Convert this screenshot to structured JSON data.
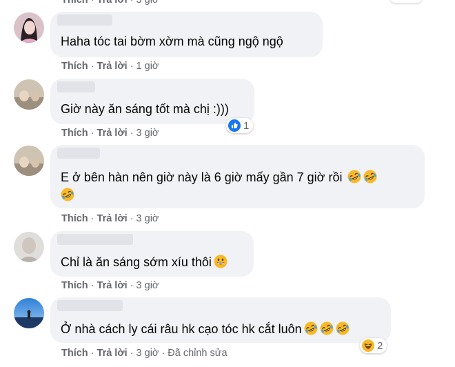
{
  "top_fragment": {
    "like": "Thích",
    "reply": "Trả lời",
    "time": "3 giờ"
  },
  "comments": [
    {
      "text": "Haha tóc tai bờm xờm mà cũng ngộ ngộ",
      "actions": {
        "like": "Thích",
        "reply": "Trả lời",
        "time": "1 giờ"
      }
    },
    {
      "text": "Giờ này ăn sáng tốt mà chị :)))",
      "reactions": {
        "count": "1",
        "icon": "like-icon"
      },
      "actions": {
        "like": "Thích",
        "reply": "Trả lời",
        "time": "3 giờ"
      }
    },
    {
      "text_line1": "E ở bên hàn nên giờ này là 6 giờ mấy gần 7 giờ rồi",
      "actions": {
        "like": "Thích",
        "reply": "Trả lời",
        "time": "3 giờ"
      }
    },
    {
      "text": "Chỉ là ăn sáng sớm xíu thôi",
      "actions": {
        "like": "Thích",
        "reply": "Trả lời",
        "time": "3 giờ"
      }
    },
    {
      "text": "Ở nhà cách ly cái râu hk cạo tóc hk cắt luôn",
      "reactions": {
        "count": "2",
        "icon": "haha-icon"
      },
      "actions": {
        "like": "Thích",
        "reply": "Trả lời",
        "time": "3 giờ",
        "edited": "Đã chỉnh sửa"
      }
    }
  ],
  "colors": {
    "bubble": "#f0f2f5",
    "meta": "#65676b",
    "like_blue": "#1877f2",
    "emoji_yellow": "#f7b125"
  }
}
